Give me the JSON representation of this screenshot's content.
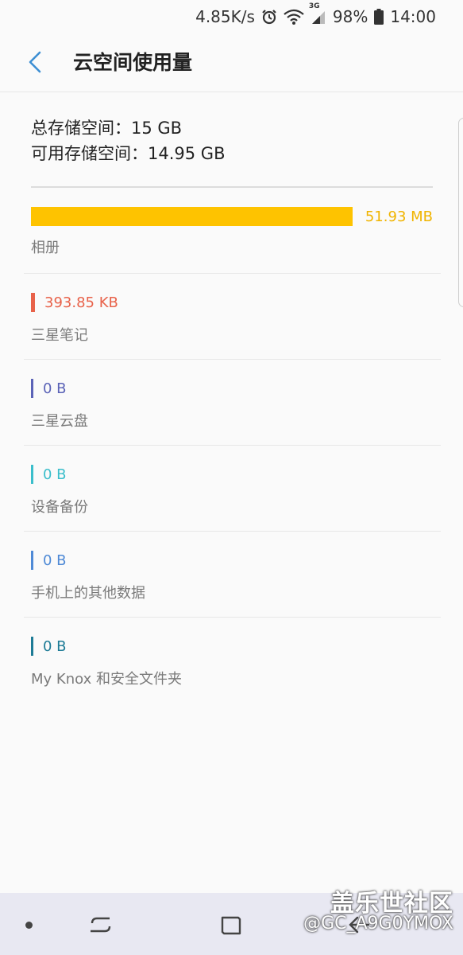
{
  "status_bar": {
    "speed": "4.85K/s",
    "network": "3G",
    "battery": "98%",
    "time": "14:00",
    "icons": [
      "alarm-icon",
      "wifi-icon",
      "signal-icon",
      "battery-icon"
    ]
  },
  "header": {
    "title": "云空间使用量",
    "back_icon": "chevron-left-icon"
  },
  "summary": {
    "total": "总存储空间：15 GB",
    "available": "可用存储空间：14.95 GB"
  },
  "items": [
    {
      "value": "51.93 MB",
      "label": "相册",
      "color": "#fec300"
    },
    {
      "value": "393.85 KB",
      "label": "三星笔记",
      "color": "#e8624a"
    },
    {
      "value": "0 B",
      "label": "三星云盘",
      "color": "#5b63b7"
    },
    {
      "value": "0 B",
      "label": "设备备份",
      "color": "#3bbecb"
    },
    {
      "value": "0 B",
      "label": "手机上的其他数据",
      "color": "#4f8ad6"
    },
    {
      "value": "0 B",
      "label": "My Knox 和安全文件夹",
      "color": "#1d7b96"
    }
  ],
  "nav_bar": {
    "icons": [
      "dot-icon",
      "recent-apps-icon",
      "home-icon",
      "back-icon"
    ]
  },
  "watermark": {
    "brand": "盖乐世社区",
    "user": "@GC_A9G0YMOX"
  }
}
